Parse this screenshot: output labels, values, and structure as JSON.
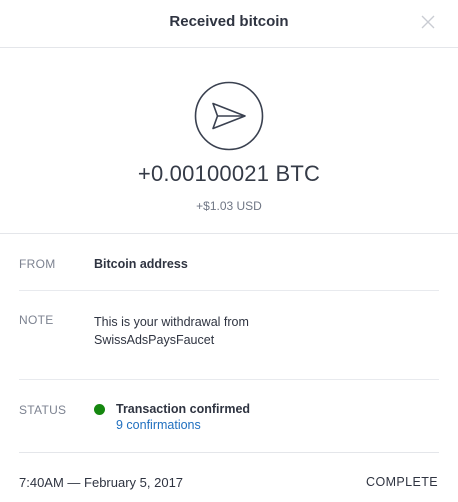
{
  "header": {
    "title": "Received bitcoin",
    "close_icon": "close-icon"
  },
  "hero": {
    "icon": "send-arrow-icon",
    "amount": "+0.00100021 BTC",
    "usd": "+$1.03 USD"
  },
  "details": {
    "from_label": "FROM",
    "from_value": "Bitcoin address",
    "note_label": "NOTE",
    "note_line1": "This is your withdrawal from",
    "note_line2": "SwissAdsPaysFaucet",
    "status_label": "STATUS",
    "status_value": "Transaction confirmed",
    "status_color": "#15870f",
    "confirmations": "9 confirmations"
  },
  "footer": {
    "datetime": "7:40AM — February 5, 2017",
    "state": "COMPLETE"
  }
}
